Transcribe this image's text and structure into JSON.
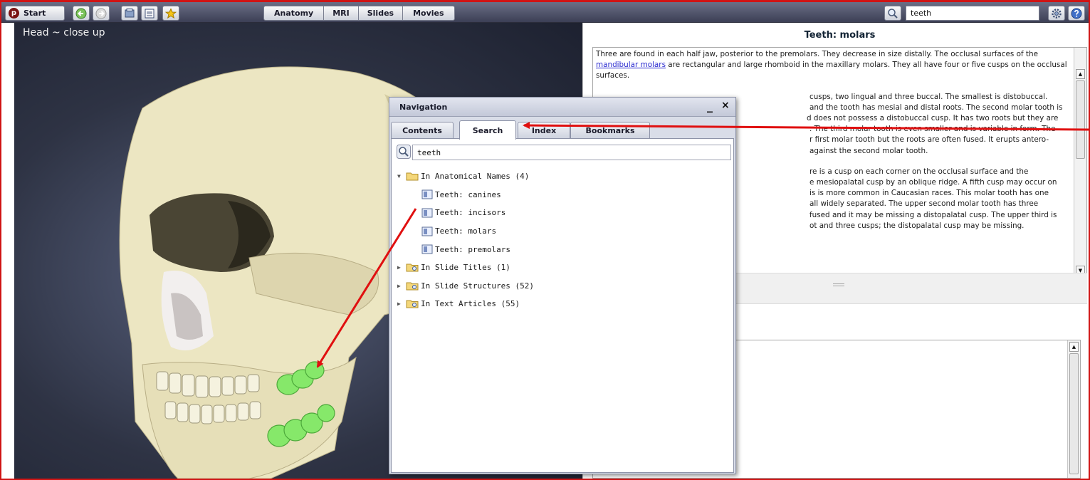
{
  "toolbar": {
    "start_label": "Start",
    "start_logo": "p",
    "nav_buttons": [
      "back-arrow-icon",
      "forward-arrow-icon",
      "folder-icon",
      "list-icon",
      "star-icon"
    ],
    "modes": [
      "Anatomy",
      "MRI",
      "Slides",
      "Movies"
    ],
    "search_value": "teeth",
    "settings_icon": "gear-icon",
    "help_icon": "help-icon"
  },
  "viewer": {
    "title": "Head ~ close up"
  },
  "article": {
    "title": "Teeth: molars",
    "para1_before_link": "Three are found in each half jaw, posterior to the premolars. They decrease in size distally. The occlusal surfaces of the ",
    "para1_link": "mandibular molars",
    "para1_after_link": " are rectangular and large rhomboid in the maxillary molars. They all have four or five cusps on the occlusal surfaces.",
    "para2_lines": [
      "cusps, two lingual and three buccal. The smallest is distobuccal.",
      "and the tooth has mesial and distal roots. The second molar tooth is",
      "d does not possess a distobuccal cusp. It has two roots but they are",
      ". The third molar tooth is even smaller and is variable in form. The",
      "r first molar tooth but the roots are often fused. It erupts antero-",
      "against the second molar tooth."
    ],
    "para3_lines": [
      "re is a cusp on each corner on the occlusal surface and the",
      "e mesiopalatal cusp by an oblique ridge. A fifth cusp may occur on",
      "is is more common in Caucasian races. This molar tooth has one",
      "all widely separated. The upper second molar tooth has three",
      "fused and it may be missing a distopalatal cusp. The upper third is",
      "ot and three cusps; the distopalatal cusp may be missing."
    ]
  },
  "navigation": {
    "title": "Navigation",
    "minimize": "_",
    "close": "×",
    "tabs": [
      "Contents",
      "Search",
      "Index",
      "Bookmarks"
    ],
    "active_tab": "Search",
    "search_value": "teeth",
    "tree": {
      "group1": "In Anatomical Names (4)",
      "group1_items": [
        "Teeth: canines",
        "Teeth: incisors",
        "Teeth: molars",
        "Teeth: premolars"
      ],
      "group2": "In Slide Titles (1)",
      "group3": "In Slide Structures (52)",
      "group4": "In Text Articles (55)"
    }
  },
  "colors": {
    "annotation_arrow": "#e01010",
    "frame_border": "#d01414",
    "highlight_teeth": "#86e86a"
  }
}
